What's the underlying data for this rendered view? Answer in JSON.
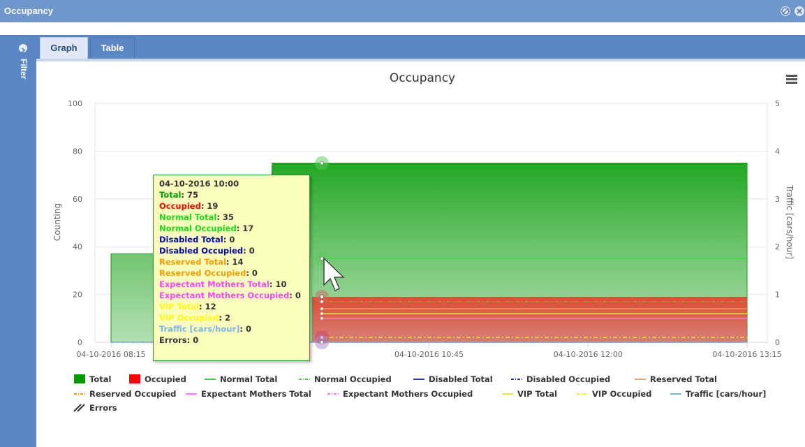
{
  "window": {
    "title": "Occupancy"
  },
  "sidebar": {
    "filter_label": "Filter"
  },
  "tabs": [
    {
      "label": "Graph",
      "active": true
    },
    {
      "label": "Table",
      "active": false
    }
  ],
  "tooltip": {
    "header": "04-10-2016 10:00",
    "rows": [
      {
        "label": "Total",
        "value": "75",
        "color": "#009900"
      },
      {
        "label": "Occupied",
        "value": "19",
        "color": "#ff0000"
      },
      {
        "label": "Normal Total",
        "value": "35",
        "color": "#19d619"
      },
      {
        "label": "Normal Occupied",
        "value": "17",
        "color": "#19d619"
      },
      {
        "label": "Disabled Total",
        "value": "0",
        "color": "#0000cc"
      },
      {
        "label": "Disabled Occupied",
        "value": " 0",
        "color": "#0000cc"
      },
      {
        "label": "Reserved Total",
        "value": "14",
        "color": "#ff9900"
      },
      {
        "label": "Reserved Occupied",
        "value": "0",
        "color": "#ff9900"
      },
      {
        "label": "Expectant Mothers Total",
        "value": "10",
        "color": "#ff44ff"
      },
      {
        "label": "Expectant Mothers Occupied",
        "value": "0",
        "color": "#ff44ff"
      },
      {
        "label": "VIP Total",
        "value": "12",
        "color": "#ffff00"
      },
      {
        "label": "VIP Occupied",
        "value": "2",
        "color": "#ffff00"
      },
      {
        "label": "Traffic [cars/hour]",
        "value": "0",
        "color": "#7cb5ec"
      },
      {
        "label": "Errors",
        "value": "0",
        "color": "#333333"
      }
    ]
  },
  "chart_data": {
    "type": "area",
    "title": "Occupancy",
    "ylabel": "Counting",
    "y2label": "Traffic [cars/hour]",
    "ylim": [
      0,
      100
    ],
    "y2lim": [
      0,
      5
    ],
    "yticks": [
      "0",
      "20",
      "40",
      "60",
      "80",
      "100"
    ],
    "y2ticks": [
      "0",
      "1",
      "2",
      "3",
      "4",
      "5"
    ],
    "xticks": [
      "04-10-2016 08:15",
      "04-10-2016 10:45",
      "04-10-2016 12:00",
      "04-10-2016 13:15"
    ],
    "series": [
      {
        "name": "Total",
        "color": "#009900",
        "style": "area",
        "points": [
          [
            "08:15",
            37
          ],
          [
            "10:00",
            75
          ],
          [
            "13:15",
            75
          ]
        ]
      },
      {
        "name": "Occupied",
        "color": "#ff0000",
        "style": "area",
        "points": [
          [
            "10:00",
            19
          ],
          [
            "13:15",
            19
          ]
        ]
      },
      {
        "name": "Normal Total",
        "color": "#33dd33",
        "style": "line",
        "points": [
          [
            "10:00",
            35
          ],
          [
            "13:15",
            35
          ]
        ]
      },
      {
        "name": "Normal Occupied",
        "color": "#33dd33",
        "style": "dashdot",
        "points": [
          [
            "10:00",
            17
          ],
          [
            "13:15",
            17
          ]
        ]
      },
      {
        "name": "Disabled Total",
        "color": "#3333cc",
        "style": "line",
        "points": [
          [
            "08:15",
            0
          ],
          [
            "13:15",
            0
          ]
        ]
      },
      {
        "name": "Disabled Occupied",
        "color": "#3333cc",
        "style": "dashdot",
        "points": [
          [
            "08:15",
            0
          ],
          [
            "13:15",
            0
          ]
        ]
      },
      {
        "name": "Reserved Total",
        "color": "#f7a35c",
        "style": "line",
        "points": [
          [
            "10:00",
            14
          ],
          [
            "13:15",
            14
          ]
        ]
      },
      {
        "name": "Reserved Occupied",
        "color": "#ff9900",
        "style": "dashdot",
        "points": [
          [
            "10:00",
            0
          ],
          [
            "13:15",
            0
          ]
        ]
      },
      {
        "name": "Expectant Mothers Total",
        "color": "#ff77ff",
        "style": "line",
        "points": [
          [
            "10:00",
            10
          ],
          [
            "13:15",
            10
          ]
        ]
      },
      {
        "name": "Expectant Mothers Occupied",
        "color": "#ff77ff",
        "style": "dashdot",
        "points": [
          [
            "10:00",
            0
          ],
          [
            "13:15",
            0
          ]
        ]
      },
      {
        "name": "VIP Total",
        "color": "#eeee22",
        "style": "line",
        "points": [
          [
            "10:00",
            12
          ],
          [
            "13:15",
            12
          ]
        ]
      },
      {
        "name": "VIP Occupied",
        "color": "#eeee22",
        "style": "dashdot",
        "points": [
          [
            "10:00",
            2
          ],
          [
            "13:15",
            2
          ]
        ]
      },
      {
        "name": "Traffic [cars/hour]",
        "color": "#7cb5ec",
        "style": "line",
        "axis": "right",
        "points": [
          [
            "08:15",
            0
          ],
          [
            "13:15",
            0
          ]
        ]
      },
      {
        "name": "Errors",
        "color": "#333333",
        "style": "hatch",
        "points": []
      }
    ],
    "legend": {
      "placement": "bottom",
      "items": [
        {
          "label": "Total",
          "marker": "square",
          "color": "#009900"
        },
        {
          "label": "Occupied",
          "marker": "square",
          "color": "#ff0000"
        },
        {
          "label": "Normal Total",
          "marker": "line",
          "color": "#33dd33"
        },
        {
          "label": "Normal Occupied",
          "marker": "dashdot",
          "color": "#33dd33"
        },
        {
          "label": "Disabled Total",
          "marker": "line",
          "color": "#3333cc"
        },
        {
          "label": "Disabled Occupied",
          "marker": "dashdot",
          "color": "#3333cc"
        },
        {
          "label": "Reserved Total",
          "marker": "line",
          "color": "#f7a35c"
        },
        {
          "label": "Reserved Occupied",
          "marker": "dashdot",
          "color": "#ff9900"
        },
        {
          "label": "Expectant Mothers Total",
          "marker": "line",
          "color": "#ff77ff"
        },
        {
          "label": "Expectant Mothers Occupied",
          "marker": "dashdot",
          "color": "#ff77ff"
        },
        {
          "label": "VIP Total",
          "marker": "line",
          "color": "#eeee22"
        },
        {
          "label": "VIP Occupied",
          "marker": "dashdot",
          "color": "#eeee22"
        },
        {
          "label": "Traffic [cars/hour]",
          "marker": "line",
          "color": "#7cb5ec"
        },
        {
          "label": "Errors",
          "marker": "hatch",
          "color": "#333333"
        }
      ]
    }
  }
}
